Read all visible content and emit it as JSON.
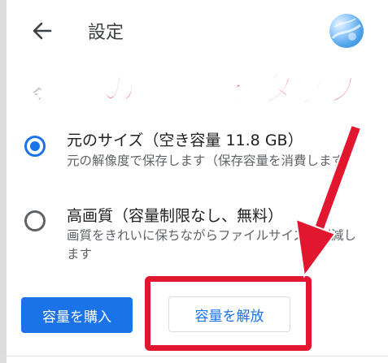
{
  "appbar": {
    "title": "設定",
    "back_icon": "arrow-left-icon",
    "avatar_icon": "account-avatar"
  },
  "annotation": {
    "headline": "「容量の解放」をタップ",
    "headline_color": "#e2162e",
    "ghost_text": "今"
  },
  "options": [
    {
      "title": "元のサイズ（空き容量 11.8 GB）",
      "description": "元の解像度で保存します（保存容量を消費します）",
      "selected": true
    },
    {
      "title": "高画質（容量制限なし、無料）",
      "description": "画質をきれいに保ちながらファイルサイズを削減します",
      "selected": false
    }
  ],
  "actions": {
    "buy_label": "容量を購入",
    "free_label": "容量を解放"
  },
  "colors": {
    "accent": "#1a73e8",
    "annotation_red": "#e2162e"
  }
}
